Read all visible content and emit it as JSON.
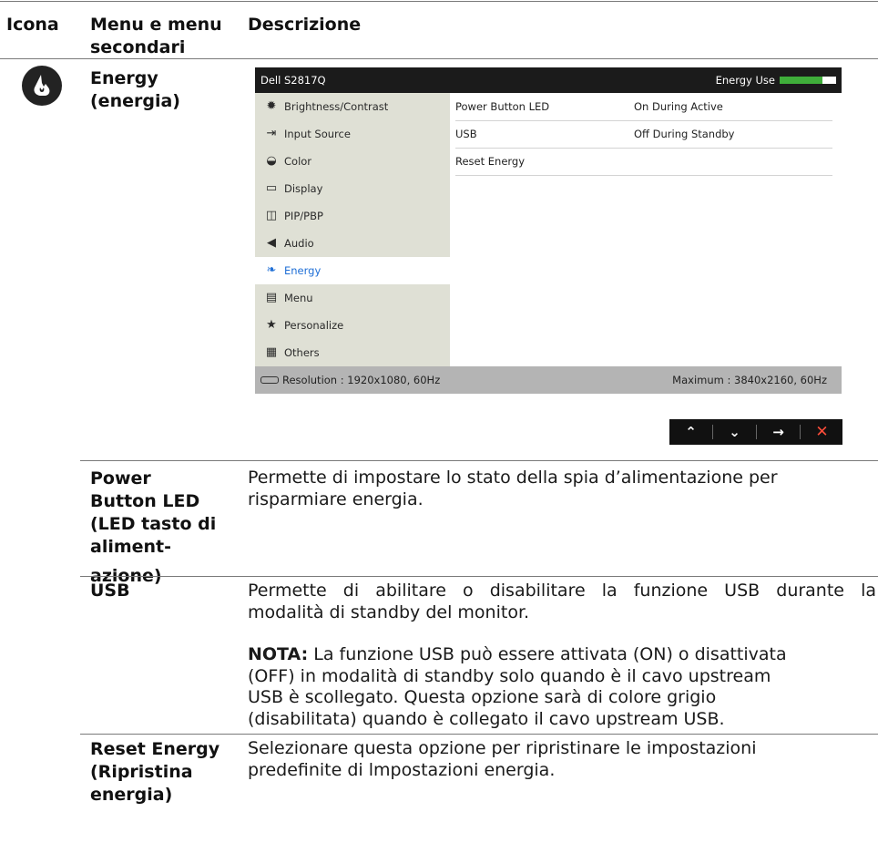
{
  "header": {
    "icon": "Icona",
    "menu_line1": "Menu e menu",
    "menu_line2": "secondari",
    "desc": "Descrizione"
  },
  "section": {
    "icon_name": "energy-icon",
    "title_line1": "Energy",
    "title_line2": "(energia)"
  },
  "osd": {
    "model": "Dell S2817Q",
    "energy_use_label": "Energy Use",
    "energy_use_level": 0.75,
    "menu": [
      {
        "label": "Brightness/Contrast",
        "icon": "brightness-icon"
      },
      {
        "label": "Input Source",
        "icon": "input-source-icon"
      },
      {
        "label": "Color",
        "icon": "color-icon"
      },
      {
        "label": "Display",
        "icon": "display-icon"
      },
      {
        "label": "PIP/PBP",
        "icon": "pip-pbp-icon"
      },
      {
        "label": "Audio",
        "icon": "audio-icon"
      },
      {
        "label": "Energy",
        "icon": "energy-icon",
        "selected": true
      },
      {
        "label": "Menu",
        "icon": "menu-icon"
      },
      {
        "label": "Personalize",
        "icon": "star-icon"
      },
      {
        "label": "Others",
        "icon": "others-icon"
      }
    ],
    "settings": [
      {
        "name": "Power Button LED",
        "value": "On During Active"
      },
      {
        "name": "USB",
        "value": "Off During Standby"
      },
      {
        "name": "Reset Energy",
        "value": ""
      }
    ],
    "resolution": "Resolution : 1920x1080, 60Hz",
    "maximum": "Maximum : 3840x2160, 60Hz",
    "nav_buttons": [
      "up-icon",
      "down-icon",
      "right-arrow-icon",
      "close-icon"
    ],
    "accent": "#1f6fd6",
    "meter_color": "#3fae3a"
  },
  "rows": {
    "power_led": {
      "term_lines": [
        "Power",
        "Button LED",
        "(LED tasto di",
        "aliment-",
        "azione)"
      ],
      "desc_lines": [
        "Permette di impostare lo stato della spia d’alimentazione per",
        "risparmiare energia."
      ]
    },
    "usb": {
      "term": "USB",
      "desc_lines": [
        "Permette di abilitare o disabilitare la funzione USB durante la",
        "modalità di standby del monitor."
      ],
      "note_label": "NOTA:",
      "note_first": " La funzione USB può essere attivata (ON) o disattivata",
      "note_lines": [
        "(OFF) in modalità di standby solo quando è il cavo upstream",
        "USB è scollegato. Questa opzione sarà di colore grigio",
        "(disabilitata) quando è collegato il cavo upstream USB."
      ]
    },
    "reset": {
      "term_lines": [
        "Reset Energy",
        "(Ripristina",
        "energia)"
      ],
      "desc_lines": [
        "Selezionare questa opzione per ripristinare le impostazioni",
        "predefinite di lmpostazioni energia."
      ]
    }
  }
}
